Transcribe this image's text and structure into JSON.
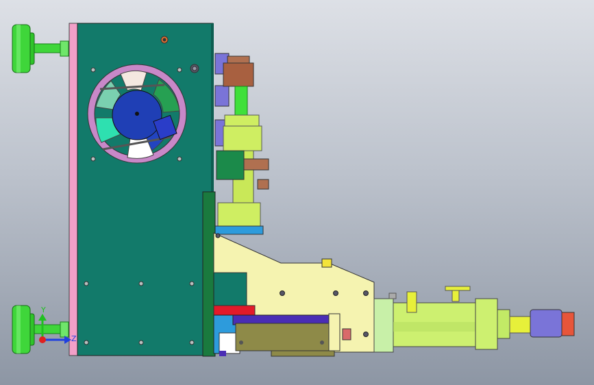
{
  "window": {
    "viewport_name": "cad-3d-viewport",
    "background_top": "#dde0e6",
    "background_bottom": "#8d96a4"
  },
  "triad": {
    "y_label": "Y",
    "z_label": "Z",
    "x_color": "#e02020",
    "y_color": "#20c020",
    "z_color": "#2040e0"
  },
  "colors": {
    "main_plate": "#127a6a",
    "side_plate": "#f2a0c8",
    "bracket": "#f5f3b0",
    "cylinder": "#cfee62",
    "green_knob": "#3fd63a",
    "fan_ring": "#c888c8",
    "fan_hub": "#1f3fb5",
    "slider_body": "#8e8a48",
    "base_plate": "#4a2db5",
    "end_cap": "#7a74d8",
    "nut": "#e7553a",
    "piston_green": "#cdf070",
    "pink_block": "#e8b0d8",
    "blue_strip": "#2d9bdc",
    "red_strip": "#e21a2a",
    "copper": "#b07050"
  }
}
